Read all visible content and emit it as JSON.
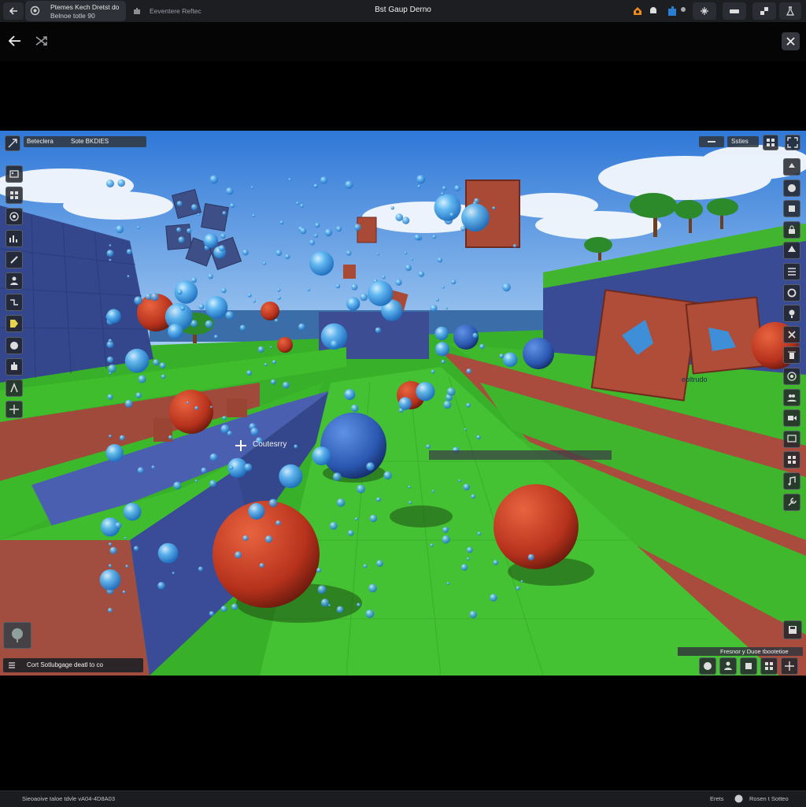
{
  "browser": {
    "active_tab_line1": "Ptemes Kech Dretst do",
    "active_tab_line2": "Belnoe totle 90",
    "inactive_tab": "Eeventere Reftec",
    "title": "Bst Gaup Derno"
  },
  "viewport": {
    "top_left_label_1": "Beteclera",
    "top_left_label_2": "Sote BKDIES",
    "top_right_label": "Ssties",
    "crosshair_label": "Coutesrry",
    "world_label": "eoltrudo",
    "bottom_left_label": "Cort Sotlubgage deatl to co",
    "bottom_right_label": "Fresnor y Duoe tbootetioe"
  },
  "status": {
    "left": "Sieoaoive taloe tdvle vA04-4D8A03",
    "right_1": "Erets",
    "right_2": "Rosen t Sotteo"
  },
  "colors": {
    "sky": "#6aa6e8",
    "grass": "#3fba2e",
    "wall_blue": "#35478f",
    "brick": "#a5493a",
    "sphere_red": "#c33a1f",
    "sphere_blue": "#2f5fb8",
    "bubble": "#4aa9ec"
  },
  "icons": {
    "left_toolbar": [
      "image-icon",
      "grid-icon",
      "target-icon",
      "chart-icon",
      "slash-icon",
      "person-icon",
      "flow-icon",
      "tag-icon",
      "face-icon",
      "robot-icon",
      "route-icon",
      "crosshair-icon"
    ],
    "right_toolbar": [
      "up-icon",
      "face-icon",
      "box-icon",
      "lock-icon",
      "tree-icon",
      "menu-icon",
      "circle-icon",
      "light-icon",
      "cross-icon",
      "trash-icon",
      "target-icon",
      "users-icon",
      "video-icon",
      "chat-icon",
      "grid-icon",
      "music-icon",
      "wrench-icon"
    ]
  }
}
